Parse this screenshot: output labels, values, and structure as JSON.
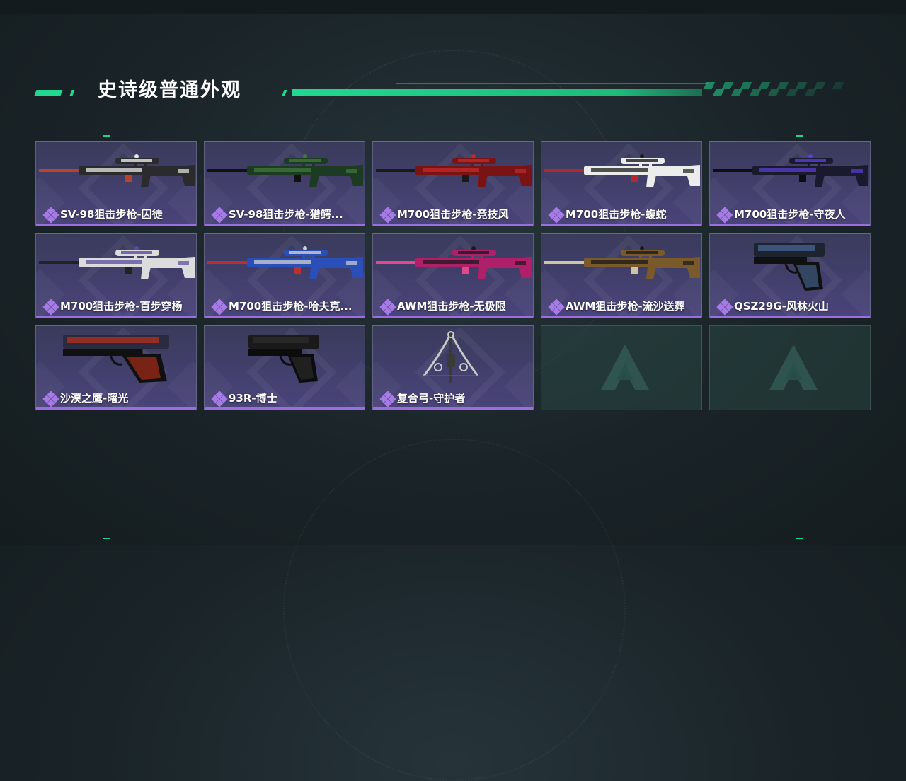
{
  "section": {
    "title": "史诗级普通外观"
  },
  "colors": {
    "accent": "#22d890",
    "rarity": "#9b6ee0",
    "card_bg": "#43406e"
  },
  "items": [
    {
      "name": "SV-98狙击步枪-囚徒",
      "type": "sniper",
      "palette": [
        "#2b2b2e",
        "#e8e8e8",
        "#b8432a"
      ]
    },
    {
      "name": "SV-98狙击步枪-猎鳄...",
      "type": "sniper",
      "palette": [
        "#1d3a22",
        "#3f7a3a",
        "#111111"
      ]
    },
    {
      "name": "M700狙击步枪-竞技风",
      "type": "sniper",
      "palette": [
        "#7a1414",
        "#c22a2a",
        "#1a1a1a"
      ]
    },
    {
      "name": "M700狙击步枪-蝮蛇",
      "type": "sniper",
      "palette": [
        "#ececec",
        "#1c1c1c",
        "#b02a2a"
      ]
    },
    {
      "name": "M700狙击步枪-守夜人",
      "type": "sniper",
      "palette": [
        "#1a1a2e",
        "#5b3fd1",
        "#0d0d14"
      ]
    },
    {
      "name": "M700狙击步枪-百步穿杨",
      "type": "sniper",
      "palette": [
        "#dcdcdc",
        "#5a4aa0",
        "#222222"
      ]
    },
    {
      "name": "M700狙击步枪-哈夫克...",
      "type": "sniper",
      "palette": [
        "#2a4fb8",
        "#d0d0d0",
        "#b83030"
      ]
    },
    {
      "name": "AWM狙击步枪-无极限",
      "type": "sniper",
      "palette": [
        "#b0206a",
        "#1a1a1a",
        "#e04a8a"
      ]
    },
    {
      "name": "AWM狙击步枪-流沙送葬",
      "type": "sniper",
      "palette": [
        "#7a5a2a",
        "#1a1a1a",
        "#cfc5a0"
      ]
    },
    {
      "name": "QSZ29G-风林火山",
      "type": "pistol",
      "palette": [
        "#1c2430",
        "#4a6a9a",
        "#101010"
      ]
    },
    {
      "name": "沙漠之鹰-曙光",
      "type": "pistol_big",
      "palette": [
        "#2a2a40",
        "#c0301a",
        "#101010"
      ]
    },
    {
      "name": "93R-博士",
      "type": "pistol",
      "palette": [
        "#1a1a1a",
        "#2e2e2e",
        "#0c0c0c"
      ]
    },
    {
      "name": "复合弓-守护者",
      "type": "bow",
      "palette": [
        "#c8c8c8",
        "#3a3a3a",
        "#6a6a6a"
      ]
    },
    {
      "name": "",
      "type": "empty",
      "palette": []
    },
    {
      "name": "",
      "type": "empty",
      "palette": []
    }
  ]
}
